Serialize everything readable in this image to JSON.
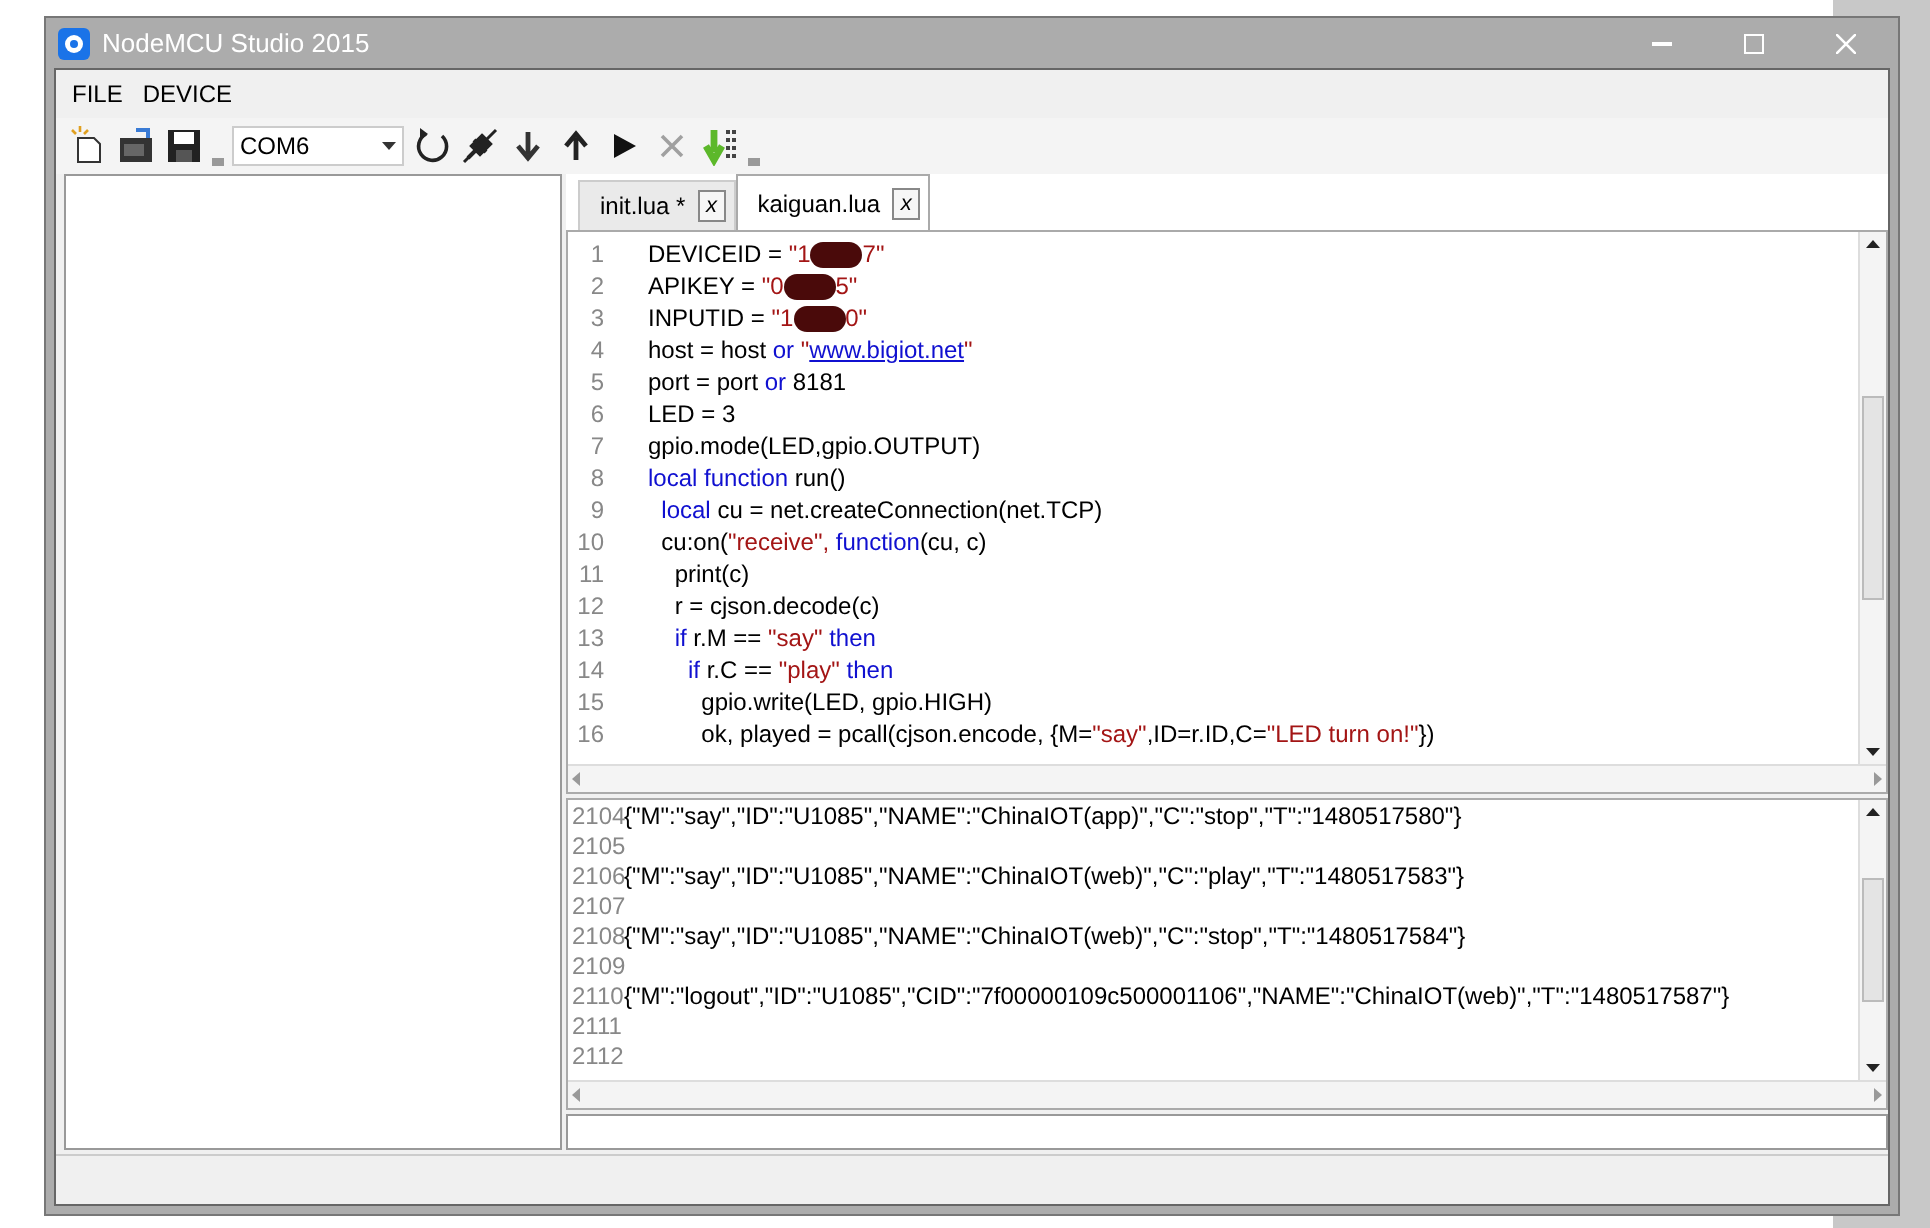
{
  "window": {
    "title": "NodeMCU Studio 2015"
  },
  "menu": [
    {
      "label": "FILE"
    },
    {
      "label": "DEVICE"
    }
  ],
  "toolbar": {
    "port": {
      "value": "COM6"
    },
    "tools": [
      {
        "kind": "new"
      },
      {
        "kind": "open"
      },
      {
        "kind": "save"
      },
      {
        "kind": "grip"
      },
      {
        "kind": "port"
      },
      {
        "kind": "refresh"
      },
      {
        "kind": "disconnect"
      },
      {
        "kind": "download"
      },
      {
        "kind": "upload"
      },
      {
        "kind": "run"
      },
      {
        "kind": "stop",
        "disabled": true
      },
      {
        "kind": "flash"
      },
      {
        "kind": "grip"
      }
    ]
  },
  "tabs": [
    {
      "label": "init.lua *",
      "close": "x",
      "selected": false
    },
    {
      "label": "kaiguan.lua",
      "close": "x",
      "selected": true
    }
  ],
  "editor": {
    "lines": [
      {
        "number": "1",
        "tokens": [
          {
            "kind": "plain",
            "text": "DEVICEID = "
          },
          {
            "kind": "string",
            "text": "\"1"
          },
          {
            "kind": "redacted"
          },
          {
            "kind": "string",
            "text": "7\""
          }
        ]
      },
      {
        "number": "2",
        "tokens": [
          {
            "kind": "plain",
            "text": "APIKEY = "
          },
          {
            "kind": "string",
            "text": "\"0"
          },
          {
            "kind": "redacted"
          },
          {
            "kind": "string",
            "text": "5\""
          }
        ]
      },
      {
        "number": "3",
        "tokens": [
          {
            "kind": "plain",
            "text": "INPUTID = "
          },
          {
            "kind": "string",
            "text": "\"1"
          },
          {
            "kind": "redacted"
          },
          {
            "kind": "string",
            "text": "0\""
          }
        ]
      },
      {
        "number": "4",
        "tokens": [
          {
            "kind": "plain",
            "text": "host = host "
          },
          {
            "kind": "keyword",
            "text": "or"
          },
          {
            "kind": "string",
            "text": " \""
          },
          {
            "kind": "link",
            "text": "www.bigiot.net"
          },
          {
            "kind": "string",
            "text": "\""
          }
        ]
      },
      {
        "number": "5",
        "tokens": [
          {
            "kind": "plain",
            "text": "port = port "
          },
          {
            "kind": "keyword",
            "text": "or"
          },
          {
            "kind": "plain",
            "text": " 8181"
          }
        ]
      },
      {
        "number": "6",
        "tokens": [
          {
            "kind": "plain",
            "text": "LED = 3"
          }
        ]
      },
      {
        "number": "7",
        "tokens": [
          {
            "kind": "plain",
            "text": "gpio.mode(LED,gpio.OUTPUT)"
          }
        ]
      },
      {
        "number": "8",
        "tokens": [
          {
            "kind": "keyword",
            "text": "local function"
          },
          {
            "kind": "plain",
            "text": " run()"
          }
        ]
      },
      {
        "number": "9",
        "tokens": [
          {
            "kind": "keyword",
            "text": "  local"
          },
          {
            "kind": "plain",
            "text": " cu = net.createConnection(net.TCP)"
          }
        ]
      },
      {
        "number": "10",
        "tokens": [
          {
            "kind": "plain",
            "text": "  cu:on("
          },
          {
            "kind": "string",
            "text": "\"receive\", "
          },
          {
            "kind": "keyword",
            "text": "function"
          },
          {
            "kind": "plain",
            "text": "(cu, c)"
          }
        ]
      },
      {
        "number": "11",
        "tokens": [
          {
            "kind": "plain",
            "text": "    print(c)"
          }
        ]
      },
      {
        "number": "12",
        "tokens": [
          {
            "kind": "plain",
            "text": "    r = cjson.decode(c)"
          }
        ]
      },
      {
        "number": "13",
        "tokens": [
          {
            "kind": "keyword",
            "text": "    if"
          },
          {
            "kind": "plain",
            "text": " r.M == "
          },
          {
            "kind": "string",
            "text": "\"say\""
          },
          {
            "kind": "keyword",
            "text": " then"
          }
        ]
      },
      {
        "number": "14",
        "tokens": [
          {
            "kind": "keyword",
            "text": "      if"
          },
          {
            "kind": "plain",
            "text": " r.C == "
          },
          {
            "kind": "string",
            "text": "\"play\""
          },
          {
            "kind": "keyword",
            "text": " then"
          }
        ]
      },
      {
        "number": "15",
        "tokens": [
          {
            "kind": "plain",
            "text": "        gpio.write(LED, gpio.HIGH)"
          }
        ]
      },
      {
        "number": "16",
        "tokens": [
          {
            "kind": "plain",
            "text": "        ok, played = pcall(cjson.encode, {M="
          },
          {
            "kind": "string",
            "text": "\"say\""
          },
          {
            "kind": "plain",
            "text": ",ID=r.ID,C="
          },
          {
            "kind": "string",
            "text": "\"LED turn on!\""
          },
          {
            "kind": "plain",
            "text": "})"
          }
        ]
      }
    ]
  },
  "output": {
    "lines": [
      {
        "number": "2104",
        "text": "{\"M\":\"say\",\"ID\":\"U1085\",\"NAME\":\"ChinaIOT(app)\",\"C\":\"stop\",\"T\":\"1480517580\"}"
      },
      {
        "number": "2105"
      },
      {
        "number": "2106",
        "text": "{\"M\":\"say\",\"ID\":\"U1085\",\"NAME\":\"ChinaIOT(web)\",\"C\":\"play\",\"T\":\"1480517583\"}"
      },
      {
        "number": "2107"
      },
      {
        "number": "2108",
        "text": "{\"M\":\"say\",\"ID\":\"U1085\",\"NAME\":\"ChinaIOT(web)\",\"C\":\"stop\",\"T\":\"1480517584\"}"
      },
      {
        "number": "2109"
      },
      {
        "number": "2110",
        "text": "{\"M\":\"logout\",\"ID\":\"U1085\",\"CID\":\"7f00000109c500001106\",\"NAME\":\"ChinaIOT(web)\",\"T\":\"1480517587\"}"
      },
      {
        "number": "2111"
      },
      {
        "number": "2112"
      }
    ]
  }
}
